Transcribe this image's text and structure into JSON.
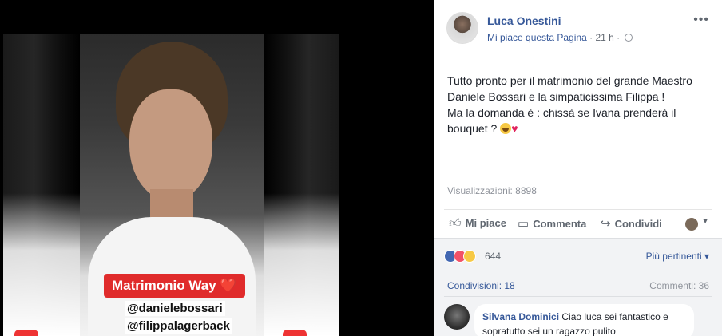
{
  "video": {
    "sticker": "Matrimonio Way ❤️",
    "tags": [
      "@danielebossari",
      "@filippalagerback"
    ]
  },
  "post": {
    "page_name": "Luca Onestini",
    "like_page": "Mi piace questa Pagina",
    "separator": "·",
    "time": "21 h",
    "text_lines": [
      "Tutto pronto per il matrimonio del grande Maestro",
      "Daniele Bossari e la simpaticissima Filippa !",
      "Ma la domanda è : chissà se Ivana prenderà il",
      "bouquet ?"
    ],
    "views_label": "Visualizzazioni:",
    "views_count": "8898"
  },
  "actions": {
    "like": "Mi piace",
    "comment": "Commenta",
    "share": "Condividi"
  },
  "reactions": {
    "count": "644",
    "sort_label": "Più pertinenti ▾"
  },
  "stats": {
    "shares": "Condivisioni: 18",
    "comments": "Commenti: 36"
  },
  "comment": {
    "author": "Silvana Dominici",
    "text": "Ciao luca sei fantastico e sopratutto sei un ragazzo pulito"
  },
  "colors": {
    "link": "#365899",
    "sticker": "#e02b2b",
    "like_blue": "#4267b2",
    "love_red": "#f25268"
  }
}
